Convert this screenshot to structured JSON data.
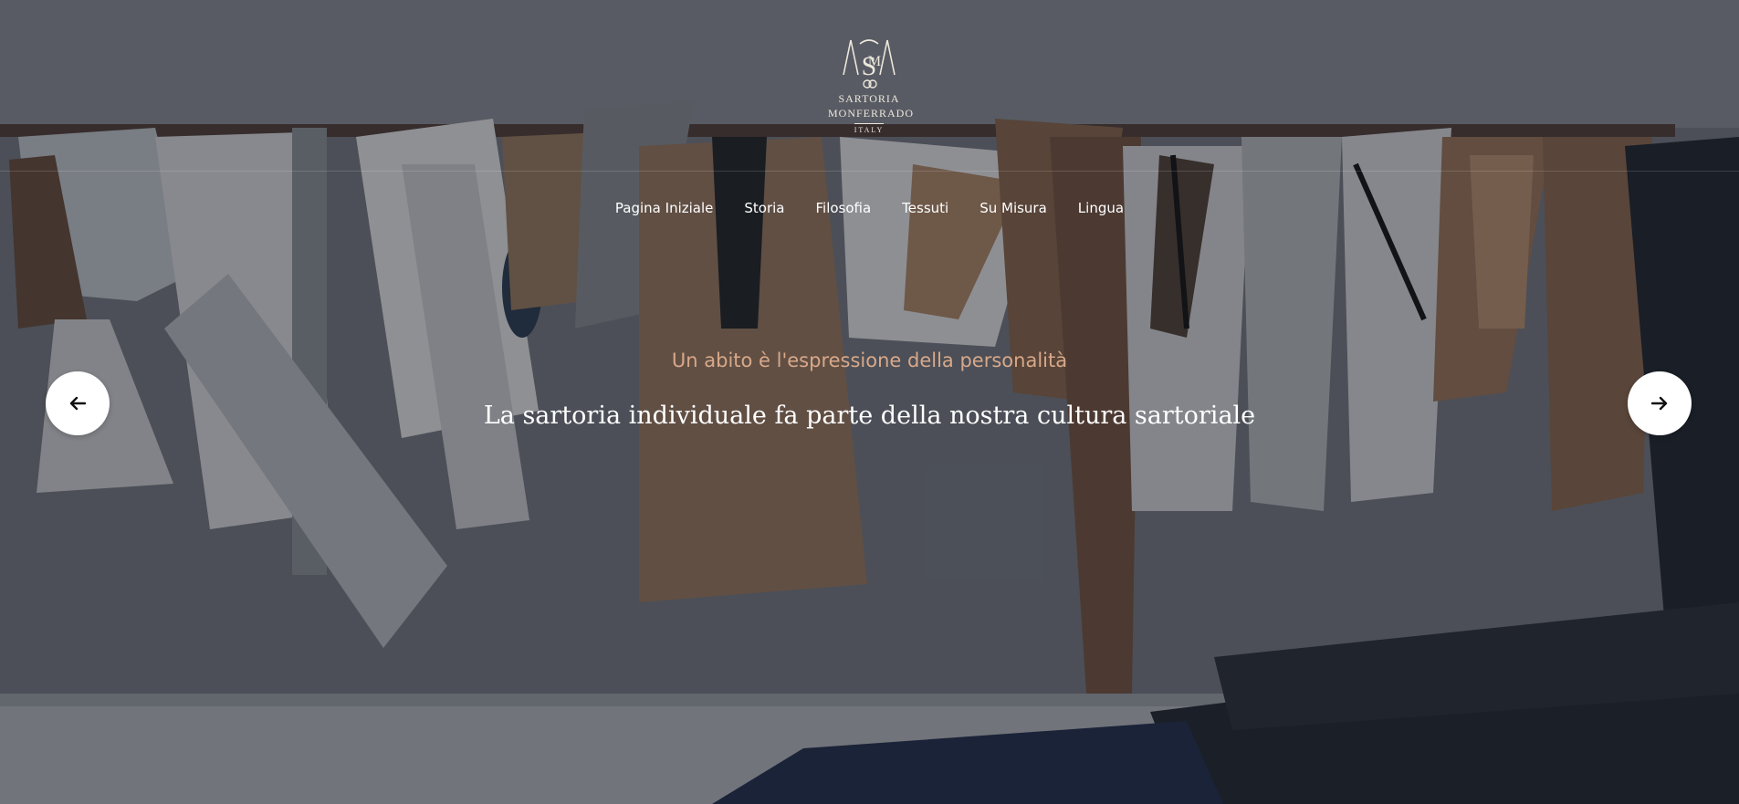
{
  "brand": {
    "name_line1": "Sartoria",
    "name_line2": "Monferrado",
    "country": "Italy",
    "logo_icon": "monogram-sm-scissors-icon"
  },
  "nav": {
    "items": [
      {
        "label": "Pagina Iniziale"
      },
      {
        "label": "Storia"
      },
      {
        "label": "Filosofia"
      },
      {
        "label": "Tessuti"
      },
      {
        "label": "Su Misura"
      },
      {
        "label": "Lingua"
      }
    ]
  },
  "hero": {
    "kicker": "Un abito è l'espressione della personalità",
    "headline": "La sartoria individuale fa parte della nostra cultura sartoriale",
    "background": "tailor-workshop-patterns-photo"
  },
  "slider": {
    "prev_icon": "arrow-left-icon",
    "next_icon": "arrow-right-icon"
  },
  "colors": {
    "accent": "#d8a889",
    "text": "#ffffff",
    "button_bg": "#ffffff"
  }
}
